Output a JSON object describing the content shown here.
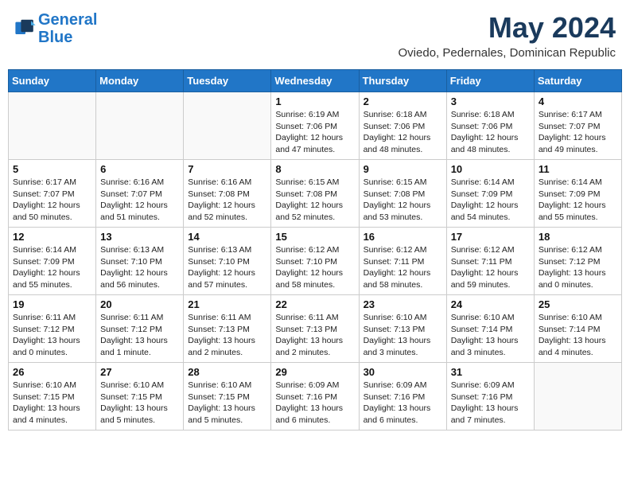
{
  "header": {
    "logo_line1": "General",
    "logo_line2": "Blue",
    "month": "May 2024",
    "location": "Oviedo, Pedernales, Dominican Republic"
  },
  "weekdays": [
    "Sunday",
    "Monday",
    "Tuesday",
    "Wednesday",
    "Thursday",
    "Friday",
    "Saturday"
  ],
  "weeks": [
    [
      {
        "day": "",
        "info": ""
      },
      {
        "day": "",
        "info": ""
      },
      {
        "day": "",
        "info": ""
      },
      {
        "day": "1",
        "info": "Sunrise: 6:19 AM\nSunset: 7:06 PM\nDaylight: 12 hours\nand 47 minutes."
      },
      {
        "day": "2",
        "info": "Sunrise: 6:18 AM\nSunset: 7:06 PM\nDaylight: 12 hours\nand 48 minutes."
      },
      {
        "day": "3",
        "info": "Sunrise: 6:18 AM\nSunset: 7:06 PM\nDaylight: 12 hours\nand 48 minutes."
      },
      {
        "day": "4",
        "info": "Sunrise: 6:17 AM\nSunset: 7:07 PM\nDaylight: 12 hours\nand 49 minutes."
      }
    ],
    [
      {
        "day": "5",
        "info": "Sunrise: 6:17 AM\nSunset: 7:07 PM\nDaylight: 12 hours\nand 50 minutes."
      },
      {
        "day": "6",
        "info": "Sunrise: 6:16 AM\nSunset: 7:07 PM\nDaylight: 12 hours\nand 51 minutes."
      },
      {
        "day": "7",
        "info": "Sunrise: 6:16 AM\nSunset: 7:08 PM\nDaylight: 12 hours\nand 52 minutes."
      },
      {
        "day": "8",
        "info": "Sunrise: 6:15 AM\nSunset: 7:08 PM\nDaylight: 12 hours\nand 52 minutes."
      },
      {
        "day": "9",
        "info": "Sunrise: 6:15 AM\nSunset: 7:08 PM\nDaylight: 12 hours\nand 53 minutes."
      },
      {
        "day": "10",
        "info": "Sunrise: 6:14 AM\nSunset: 7:09 PM\nDaylight: 12 hours\nand 54 minutes."
      },
      {
        "day": "11",
        "info": "Sunrise: 6:14 AM\nSunset: 7:09 PM\nDaylight: 12 hours\nand 55 minutes."
      }
    ],
    [
      {
        "day": "12",
        "info": "Sunrise: 6:14 AM\nSunset: 7:09 PM\nDaylight: 12 hours\nand 55 minutes."
      },
      {
        "day": "13",
        "info": "Sunrise: 6:13 AM\nSunset: 7:10 PM\nDaylight: 12 hours\nand 56 minutes."
      },
      {
        "day": "14",
        "info": "Sunrise: 6:13 AM\nSunset: 7:10 PM\nDaylight: 12 hours\nand 57 minutes."
      },
      {
        "day": "15",
        "info": "Sunrise: 6:12 AM\nSunset: 7:10 PM\nDaylight: 12 hours\nand 58 minutes."
      },
      {
        "day": "16",
        "info": "Sunrise: 6:12 AM\nSunset: 7:11 PM\nDaylight: 12 hours\nand 58 minutes."
      },
      {
        "day": "17",
        "info": "Sunrise: 6:12 AM\nSunset: 7:11 PM\nDaylight: 12 hours\nand 59 minutes."
      },
      {
        "day": "18",
        "info": "Sunrise: 6:12 AM\nSunset: 7:12 PM\nDaylight: 13 hours\nand 0 minutes."
      }
    ],
    [
      {
        "day": "19",
        "info": "Sunrise: 6:11 AM\nSunset: 7:12 PM\nDaylight: 13 hours\nand 0 minutes."
      },
      {
        "day": "20",
        "info": "Sunrise: 6:11 AM\nSunset: 7:12 PM\nDaylight: 13 hours\nand 1 minute."
      },
      {
        "day": "21",
        "info": "Sunrise: 6:11 AM\nSunset: 7:13 PM\nDaylight: 13 hours\nand 2 minutes."
      },
      {
        "day": "22",
        "info": "Sunrise: 6:11 AM\nSunset: 7:13 PM\nDaylight: 13 hours\nand 2 minutes."
      },
      {
        "day": "23",
        "info": "Sunrise: 6:10 AM\nSunset: 7:13 PM\nDaylight: 13 hours\nand 3 minutes."
      },
      {
        "day": "24",
        "info": "Sunrise: 6:10 AM\nSunset: 7:14 PM\nDaylight: 13 hours\nand 3 minutes."
      },
      {
        "day": "25",
        "info": "Sunrise: 6:10 AM\nSunset: 7:14 PM\nDaylight: 13 hours\nand 4 minutes."
      }
    ],
    [
      {
        "day": "26",
        "info": "Sunrise: 6:10 AM\nSunset: 7:15 PM\nDaylight: 13 hours\nand 4 minutes."
      },
      {
        "day": "27",
        "info": "Sunrise: 6:10 AM\nSunset: 7:15 PM\nDaylight: 13 hours\nand 5 minutes."
      },
      {
        "day": "28",
        "info": "Sunrise: 6:10 AM\nSunset: 7:15 PM\nDaylight: 13 hours\nand 5 minutes."
      },
      {
        "day": "29",
        "info": "Sunrise: 6:09 AM\nSunset: 7:16 PM\nDaylight: 13 hours\nand 6 minutes."
      },
      {
        "day": "30",
        "info": "Sunrise: 6:09 AM\nSunset: 7:16 PM\nDaylight: 13 hours\nand 6 minutes."
      },
      {
        "day": "31",
        "info": "Sunrise: 6:09 AM\nSunset: 7:16 PM\nDaylight: 13 hours\nand 7 minutes."
      },
      {
        "day": "",
        "info": ""
      }
    ]
  ]
}
